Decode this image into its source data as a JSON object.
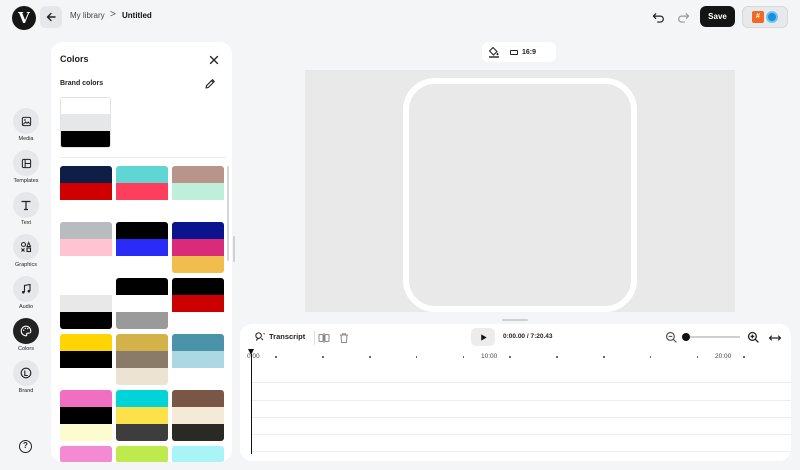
{
  "topbar": {
    "logo": "V",
    "breadcrumb": [
      "My library",
      ">",
      "Untitled"
    ],
    "save_label": "Save",
    "brand_badge": "#"
  },
  "rail": [
    {
      "label": "Media",
      "icon": "image-icon",
      "active": false
    },
    {
      "label": "Templates",
      "icon": "templates-icon",
      "active": false
    },
    {
      "label": "Text",
      "icon": "text-icon",
      "active": false
    },
    {
      "label": "Graphics",
      "icon": "graphics-icon",
      "active": false
    },
    {
      "label": "Audio",
      "icon": "music-note-icon",
      "active": false
    },
    {
      "label": "Colors",
      "icon": "palette-icon",
      "active": true
    },
    {
      "label": "Brand",
      "icon": "brand-icon",
      "active": false
    }
  ],
  "help": "?",
  "colors_panel": {
    "title": "Colors",
    "brand_colors_title": "Brand colors",
    "brand_palette": [
      "#ffffff",
      "#e6e7e8",
      "#000000"
    ],
    "palettes": [
      [
        "#0e1e46",
        "#d10000"
      ],
      [
        "#5fd6d3",
        "#ff3d5c"
      ],
      [
        "#b8958a",
        "#bfeedb"
      ],
      [
        "#b9bcbf",
        "#ffc3d1"
      ],
      [
        "#000000",
        "#2b2bf7"
      ],
      [
        "#0a148c",
        "#d92b7a",
        "#f1be4d"
      ],
      [
        "#ffffff",
        "#e8e8e8",
        "#000000"
      ],
      [
        "#000000",
        "#ffffff",
        "#9a9a9a"
      ],
      [
        "#000000",
        "#cc0000"
      ],
      [
        "#ffd400",
        "#000000",
        "#ffffff"
      ],
      [
        "#d4b24a",
        "#8a7b68",
        "#ece3d3"
      ],
      [
        "#4a93a8",
        "#abd8e3",
        "#ffffff"
      ],
      [
        "#f06fc2",
        "#000000",
        "#fdfccf"
      ],
      [
        "#00d4d9",
        "#fde14a",
        "#3d3d3d"
      ],
      [
        "#7a5646",
        "#f3ebd8",
        "#2a2a24"
      ],
      [
        "#f48bd2"
      ],
      [
        "#bfea4d"
      ],
      [
        "#a9f4f6"
      ]
    ]
  },
  "canvas": {
    "ratio_label": "16:9",
    "background": "#e9e9ea"
  },
  "timeline": {
    "transcript_label": "Transcript",
    "time_current": "0:00.00",
    "time_sep": "/",
    "time_total": "7:20.43",
    "ruler_labels": [
      "0:00",
      "10:00",
      "20:00"
    ],
    "zoom_level": 0.08
  }
}
